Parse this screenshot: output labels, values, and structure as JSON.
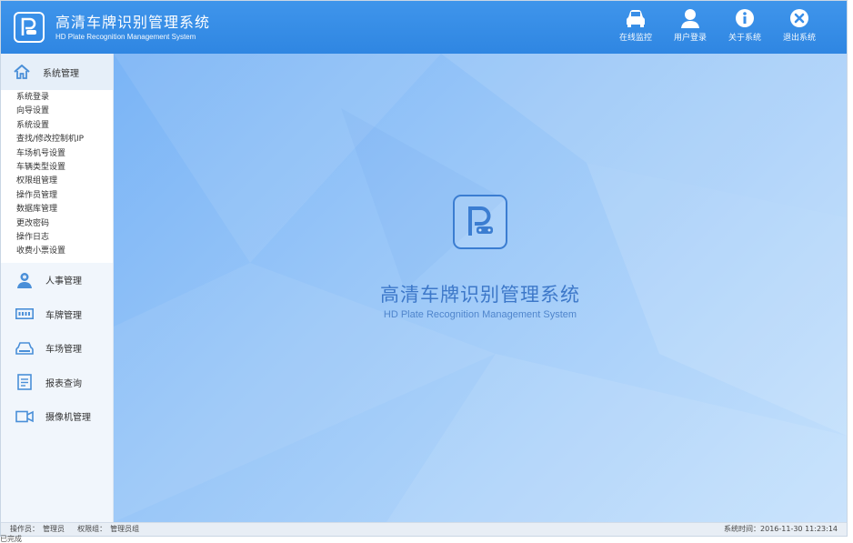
{
  "header": {
    "title": "高清车牌识别管理系统",
    "subtitle": "HD Plate Recognition Management System",
    "nav": [
      {
        "label": "在线监控",
        "icon": "car-icon"
      },
      {
        "label": "用户登录",
        "icon": "user-icon"
      },
      {
        "label": "关于系统",
        "icon": "info-icon"
      },
      {
        "label": "退出系统",
        "icon": "close-icon"
      }
    ]
  },
  "sidebar": {
    "expanded_group": {
      "label": "系统管理",
      "icon": "home-icon",
      "items": [
        "系统登录",
        "向导设置",
        "系统设置",
        "查找/修改控制机IP",
        "车场机号设置",
        "车辆类型设置",
        "权限组管理",
        "操作员管理",
        "数据库管理",
        "更改密码",
        "操作日志",
        "收费小票设置"
      ]
    },
    "groups": [
      {
        "label": "人事管理",
        "icon": "person-icon"
      },
      {
        "label": "车牌管理",
        "icon": "license-plate-icon"
      },
      {
        "label": "车场管理",
        "icon": "car-front-icon"
      },
      {
        "label": "报表查询",
        "icon": "report-icon"
      },
      {
        "label": "摄像机管理",
        "icon": "camera-icon"
      }
    ]
  },
  "main": {
    "title": "高清车牌识别管理系统",
    "subtitle": "HD Plate Recognition Management System"
  },
  "status": {
    "operator_label": "操作员：",
    "operator_value": "管理员",
    "group_label": "权限组：",
    "group_value": "管理员组",
    "time_label": "系统时间：",
    "time_value": "2016-11-30 11:23:14"
  },
  "below_text": "已完成"
}
